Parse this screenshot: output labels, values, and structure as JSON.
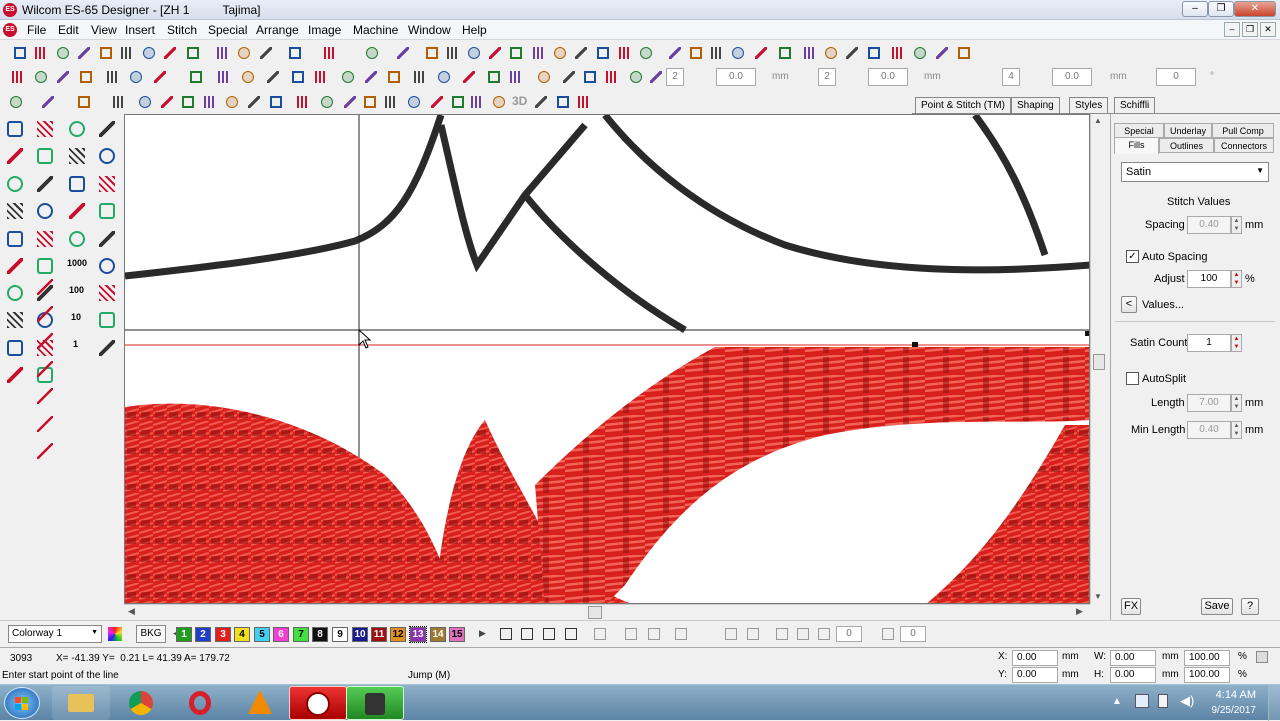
{
  "window": {
    "title": "Wilcom ES-65 Designer - [ZH 1          Tajima]",
    "app_icon": "ES"
  },
  "menu": [
    "File",
    "Edit",
    "View",
    "Insert",
    "Stitch",
    "Special",
    "Arrange",
    "Image",
    "Machine",
    "Window",
    "Help"
  ],
  "toolbar2": {
    "spin_a": "2",
    "val_a": "0.0",
    "unit_a": "mm",
    "spin_b": "2",
    "val_b": "0.0",
    "unit_b": "mm",
    "spin_c": "4",
    "val_c": "0.0",
    "unit_c": "mm",
    "val_d": "0",
    "unit_d": "°"
  },
  "toolbar3": {
    "label_3d": "3D"
  },
  "toolbar_tabs": [
    "Point & Stitch (TM)",
    "Shaping",
    "Styles",
    "Schiffli"
  ],
  "left_tools": {
    "n1000": "1000",
    "n100": "100",
    "n10": "10",
    "n1": "1"
  },
  "panel": {
    "tabs_row1": [
      "Special",
      "Underlay",
      "Pull Comp"
    ],
    "tabs_row2": [
      "Fills",
      "Outlines",
      "Connectors"
    ],
    "fill_type": "Satin",
    "section_title": "Stitch Values",
    "spacing_label": "Spacing",
    "spacing_value": "0.40",
    "spacing_unit": "mm",
    "auto_spacing_label": "Auto Spacing",
    "auto_spacing_checked": true,
    "adjust_label": "Adjust",
    "adjust_value": "100",
    "adjust_unit": "%",
    "values_label": "Values...",
    "satin_count_label": "Satin Count",
    "satin_count_value": "1",
    "autosplit_label": "AutoSplit",
    "length_label": "Length",
    "length_value": "7.00",
    "length_unit": "mm",
    "min_length_label": "Min Length",
    "min_length_value": "0.40",
    "min_length_unit": "mm",
    "fx_label": "FX",
    "save_label": "Save",
    "help_label": "?"
  },
  "colorbar": {
    "colorway": "Colorway 1",
    "bkg": "BKG",
    "swatches": [
      {
        "n": "1",
        "color": "#1f9d1f",
        "fg": "#fff"
      },
      {
        "n": "2",
        "color": "#1f3fc8",
        "fg": "#fff"
      },
      {
        "n": "3",
        "color": "#e02020",
        "fg": "#fff"
      },
      {
        "n": "4",
        "color": "#f0e020",
        "fg": "#000"
      },
      {
        "n": "5",
        "color": "#40d0f0",
        "fg": "#000"
      },
      {
        "n": "6",
        "color": "#f040d0",
        "fg": "#fff"
      },
      {
        "n": "7",
        "color": "#40e040",
        "fg": "#000"
      },
      {
        "n": "8",
        "color": "#101010",
        "fg": "#fff"
      },
      {
        "n": "9",
        "color": "#ffffff",
        "fg": "#000"
      },
      {
        "n": "10",
        "color": "#1a1a90",
        "fg": "#fff"
      },
      {
        "n": "11",
        "color": "#a01010",
        "fg": "#fff"
      },
      {
        "n": "12",
        "color": "#e09020",
        "fg": "#000"
      },
      {
        "n": "13",
        "color": "#9030b0",
        "fg": "#fff"
      },
      {
        "n": "14",
        "color": "#a07830",
        "fg": "#fff"
      },
      {
        "n": "15",
        "color": "#e070c0",
        "fg": "#000"
      }
    ],
    "spin_a": "0",
    "spin_b": "0"
  },
  "status": {
    "stitch_count": "3093",
    "coords": "X= -41.39 Y=  0.21 L= 41.39 A= 179.72",
    "prompt": "Enter start point of the line",
    "mode": "Jump (M)",
    "x_label": "X:",
    "x_value": "0.00",
    "x_unit": "mm",
    "y_label": "Y:",
    "y_value": "0.00",
    "y_unit": "mm",
    "w_label": "W:",
    "w_value": "0.00",
    "w_unit": "mm",
    "h_label": "H:",
    "h_value": "0.00",
    "h_unit": "mm",
    "wp_value": "100.00",
    "wp_unit": "%",
    "hp_value": "100.00",
    "hp_unit": "%"
  },
  "taskbar": {
    "time": "4:14 AM",
    "date": "9/25/2017"
  },
  "colors": {
    "thread_red": "#d8201c",
    "thread_dark": "#8e0e0c",
    "outline": "#2a2a2a"
  }
}
